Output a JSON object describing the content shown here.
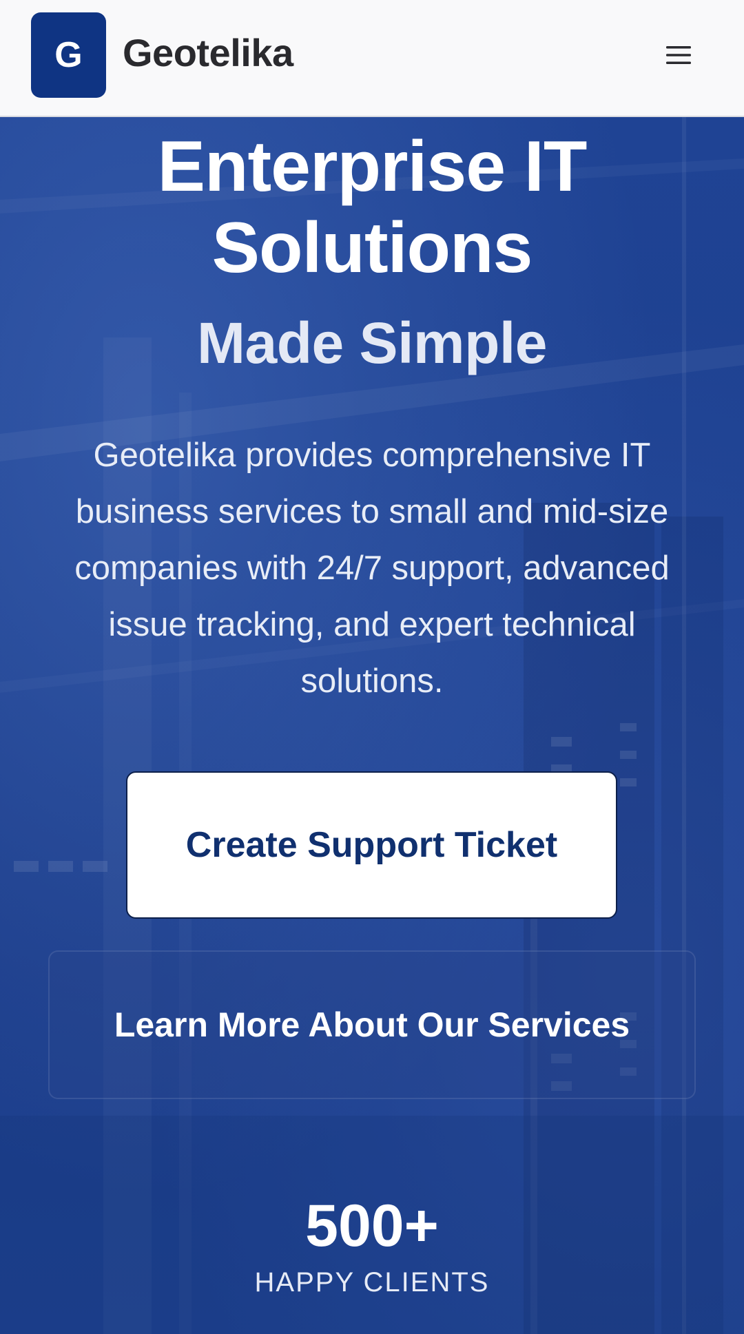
{
  "header": {
    "logo_letter": "G",
    "brand_name": "Geotelika",
    "menu_icon": "hamburger-menu-icon"
  },
  "hero": {
    "title_line1": "Enterprise IT",
    "title_line2": "Solutions",
    "subtitle": "Made Simple",
    "description": "Geotelika provides comprehensive IT business services to small and mid-size companies with 24/7 support, advanced issue tracking, and expert technical solutions.",
    "primary_cta": "Create Support Ticket",
    "secondary_cta": "Learn More About Our Services"
  },
  "stats": [
    {
      "value": "500+",
      "label": "HAPPY CLIENTS"
    }
  ],
  "colors": {
    "brand_blue": "#0f3483",
    "hero_background": "#1d3f8c",
    "header_background": "#f9f9fa",
    "primary_button_text": "#10306f"
  }
}
